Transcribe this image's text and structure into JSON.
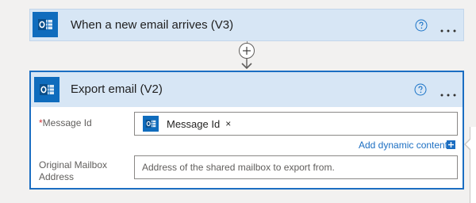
{
  "trigger": {
    "title": "When a new email arrives (V3)",
    "icon": "outlook-icon",
    "help_icon": "help-icon",
    "more_icon": "more-options-icon"
  },
  "connector": {
    "add_step_icon": "plus-icon",
    "arrow_icon": "arrow-down-icon"
  },
  "action": {
    "title": "Export email (V2)",
    "icon": "outlook-icon",
    "help_icon": "help-icon",
    "more_icon": "more-options-icon",
    "fields": {
      "message_id": {
        "required_mark": "*",
        "label": "Message Id",
        "token": {
          "label": "Message Id",
          "remove_symbol": "×",
          "icon": "outlook-icon"
        }
      },
      "mailbox": {
        "label_line1": "Original Mailbox",
        "label_line2": "Address",
        "placeholder": "Address of the shared mailbox to export from."
      }
    },
    "dynamic_content": {
      "label": "Add dynamic content",
      "icon": "add-dynamic-content-icon"
    }
  },
  "colors": {
    "accent": "#1b6ec2",
    "outlook_blue": "#0f6cbd",
    "header_bg": "#d7e6f5",
    "required": "#d13438"
  }
}
